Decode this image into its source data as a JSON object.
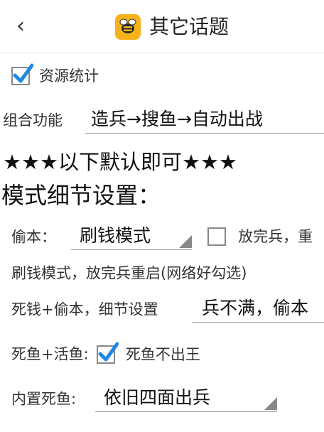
{
  "header": {
    "back_icon": "‹",
    "title": "其它话题"
  },
  "settings": {
    "resource_stats": {
      "label": "资源统计",
      "checked": true
    },
    "combo": {
      "label": "组合功能",
      "value": "造兵→搜鱼→自动出战"
    },
    "default_note": "★★★以下默认即可★★★",
    "mode_heading": "模式细节设置：",
    "steal": {
      "label": "偷本：",
      "value": "刷钱模式",
      "checkbox_label": "放完兵，重",
      "checked": false
    },
    "farm_desc": "刷钱模式，放完兵重启(网络好勾选)",
    "dead_steal": {
      "label": "死钱+偷本，细节设置",
      "value": "兵不满，偷本"
    },
    "dead_live": {
      "label": "死鱼+活鱼:",
      "checkbox_label": "死鱼不出王",
      "checked": true
    },
    "builtin": {
      "label": "内置死鱼:",
      "value": "依旧四面出兵"
    }
  },
  "colors": {
    "check": "#1e88e5",
    "accent": "#f6b21a"
  }
}
